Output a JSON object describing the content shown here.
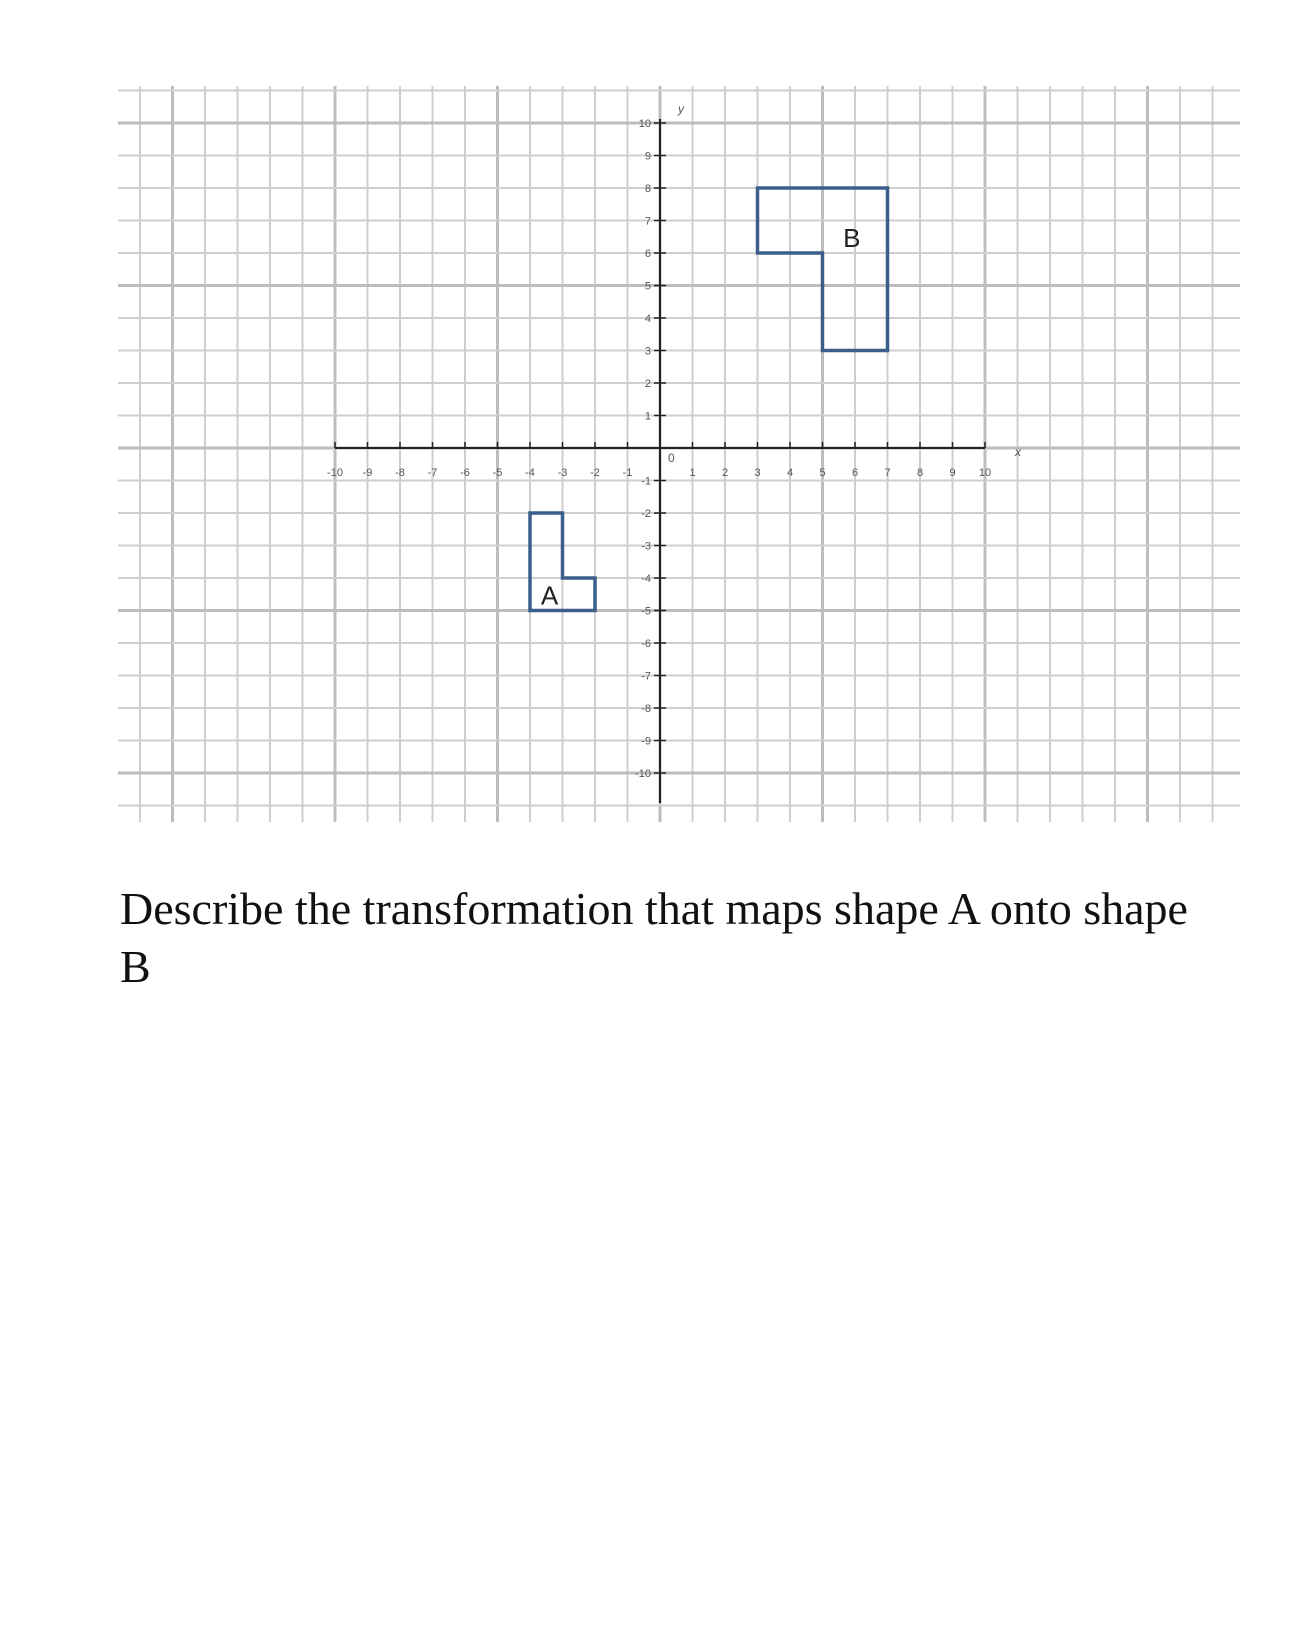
{
  "figure": {
    "x_axis_label": "x",
    "y_axis_label": "y",
    "origin_label": "0",
    "x_range": [
      -10,
      10
    ],
    "y_range": [
      -10,
      10
    ],
    "x_tick_labels": [
      "-10",
      "-9",
      "-8",
      "-7",
      "-6",
      "-5",
      "-4",
      "-3",
      "-2",
      "-1",
      "1",
      "2",
      "3",
      "4",
      "5",
      "6",
      "7",
      "8",
      "9",
      "10"
    ],
    "y_tick_labels": [
      "10",
      "9",
      "8",
      "7",
      "6",
      "5",
      "4",
      "3",
      "2",
      "1",
      "-1",
      "-2",
      "-3",
      "-4",
      "-5",
      "-6",
      "-7",
      "-8",
      "-9",
      "-10"
    ],
    "grid": true,
    "shape_color": "#3b5f8a",
    "shapes": [
      {
        "label": "A",
        "vertices": [
          [
            -3,
            -2
          ],
          [
            -4,
            -2
          ],
          [
            -4,
            -5
          ],
          [
            -2,
            -5
          ],
          [
            -2,
            -4
          ],
          [
            -3,
            -4
          ]
        ]
      },
      {
        "label": "B",
        "vertices": [
          [
            3,
            8
          ],
          [
            7,
            8
          ],
          [
            7,
            3
          ],
          [
            5,
            3
          ],
          [
            5,
            6
          ],
          [
            3,
            6
          ]
        ]
      }
    ]
  },
  "question": {
    "text": "Describe the transformation that maps shape A onto shape B"
  }
}
